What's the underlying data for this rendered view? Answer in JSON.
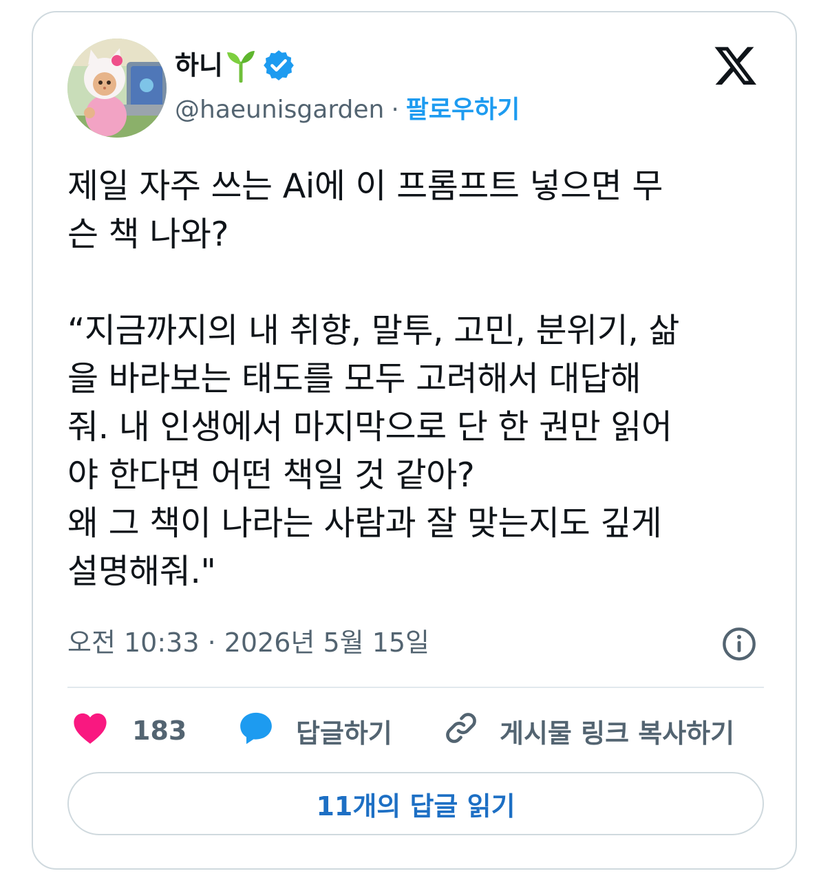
{
  "author": {
    "display_name": "하니",
    "handle": "@haeunisgarden",
    "separator": "·",
    "follow_label": "팔로우하기",
    "verified": true
  },
  "tweet": {
    "text": "제일 자주 쓰는 Ai에 이 프롬프트 넣으면 무\n슨 책 나와?\n\n“지금까지의 내 취향, 말투, 고민, 분위기, 삶\n을 바라보는 태도를 모두 고려해서 대답해\n줘. 내 인생에서 마지막으로 단 한 권만 읽어\n야 한다면 어떤 책일 것 같아?\n왜 그 책이 나라는 사람과 잘 맞는지도 깊게\n설명해줘.\"",
    "timestamp": "오전 10:33 · 2026년 5월 15일"
  },
  "actions": {
    "like_count": "183",
    "reply_label": "답글하기",
    "copy_link_label": "게시물 링크 복사하기"
  },
  "read_replies_label": "11개의 답글 읽기",
  "icons": {
    "logo": "x-logo-icon",
    "verified": "verified-badge-icon",
    "sprout": "sprout-emoji-icon",
    "info": "info-icon",
    "like": "heart-icon",
    "reply": "speech-bubble-icon",
    "link": "link-icon"
  },
  "colors": {
    "accent": "#1d9bf0",
    "heart": "#f91880",
    "muted": "#536471",
    "border": "#cfd9de"
  }
}
